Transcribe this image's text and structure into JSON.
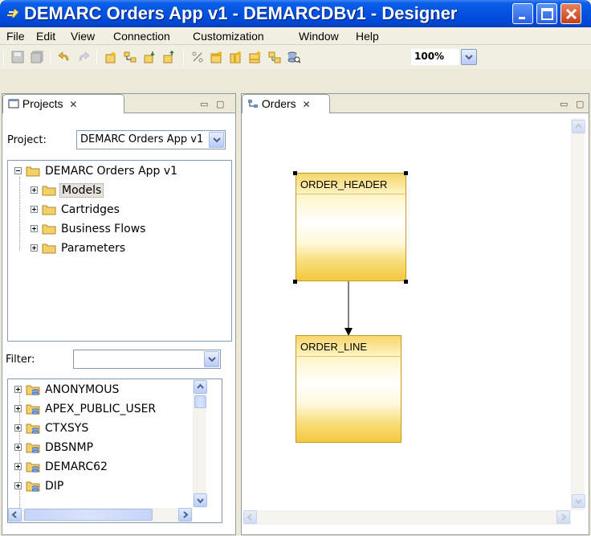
{
  "window": {
    "title": "DEMARC Orders App v1 - DEMARCDBv1 - Designer"
  },
  "menu": [
    "File",
    "Edit",
    "View",
    "Connection",
    "Customization",
    "Window",
    "Help"
  ],
  "toolbar": {
    "zoom": "100%"
  },
  "projects_view": {
    "tab_label": "Projects",
    "project_label": "Project:",
    "project_value": "DEMARC Orders App v1",
    "tree": {
      "root": "DEMARC Orders App v1",
      "children": [
        "Models",
        "Cartridges",
        "Business Flows",
        "Parameters"
      ],
      "selected": "Models"
    },
    "filter_label": "Filter:",
    "filter_value": "",
    "schemas": [
      "ANONYMOUS",
      "APEX_PUBLIC_USER",
      "CTXSYS",
      "DBSNMP",
      "DEMARC62",
      "DIP"
    ]
  },
  "editor": {
    "tab_label": "Orders",
    "entities": {
      "header": "ORDER_HEADER",
      "line": "ORDER_LINE"
    }
  },
  "colors": {
    "titlebar": "#0351E0",
    "entity_fill": "#F4C93F",
    "entity_border": "#C99A20"
  }
}
